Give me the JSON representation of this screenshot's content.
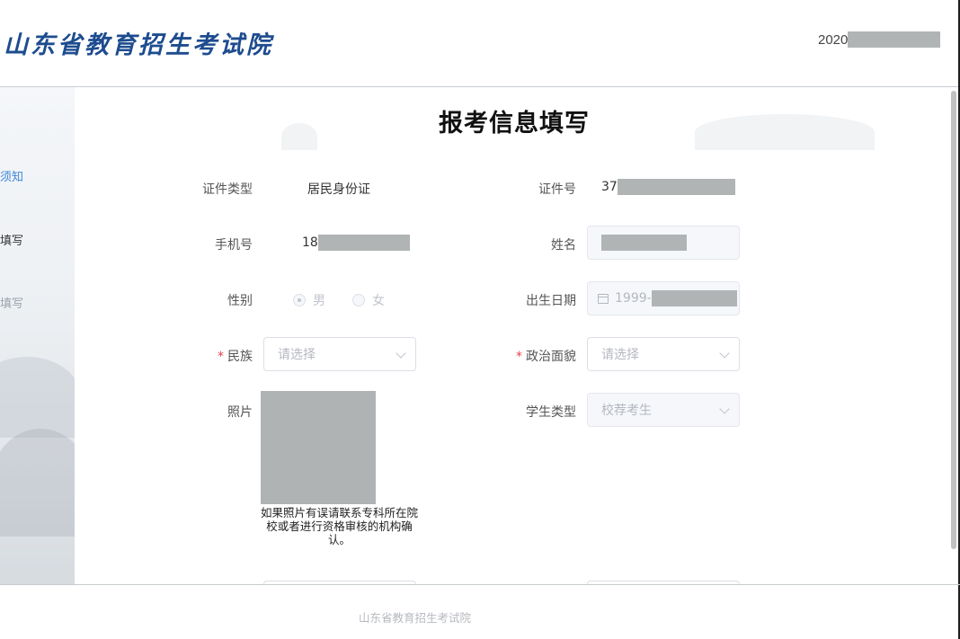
{
  "header": {
    "logo_text": "山东省教育招生考试院",
    "user_prefix": "2020"
  },
  "sidebar": {
    "items": [
      {
        "label": "须知",
        "state": "active"
      },
      {
        "label": "填写",
        "state": "current"
      },
      {
        "label": "填写",
        "state": "dim"
      }
    ]
  },
  "form": {
    "title": "报考信息填写",
    "id_type": {
      "label": "证件类型",
      "value": "居民身份证"
    },
    "id_number": {
      "label": "证件号",
      "value_prefix": "37"
    },
    "phone": {
      "label": "手机号",
      "value_prefix": "18"
    },
    "name": {
      "label": "姓名"
    },
    "gender": {
      "label": "性别",
      "options": [
        "男",
        "女"
      ],
      "selected": "男"
    },
    "birth_date": {
      "label": "出生日期",
      "value_prefix": "1999-"
    },
    "ethnicity": {
      "label": "民族",
      "required_mark": "*",
      "placeholder": "请选择"
    },
    "political_status": {
      "label": "政治面貌",
      "required_mark": "*",
      "placeholder": "请选择"
    },
    "photo": {
      "label": "照片",
      "note": "如果照片有误请联系专科所在院校或者进行资格审核的机构确认。"
    },
    "student_type": {
      "label": "学生类型",
      "value": "校荐考生"
    }
  },
  "footer": {
    "text": "山东省教育招生考试院"
  },
  "colors": {
    "logo": "#1d4c8f",
    "active_link": "#3d86d8",
    "required": "#e5414a",
    "redaction": "#b0b4b5"
  }
}
